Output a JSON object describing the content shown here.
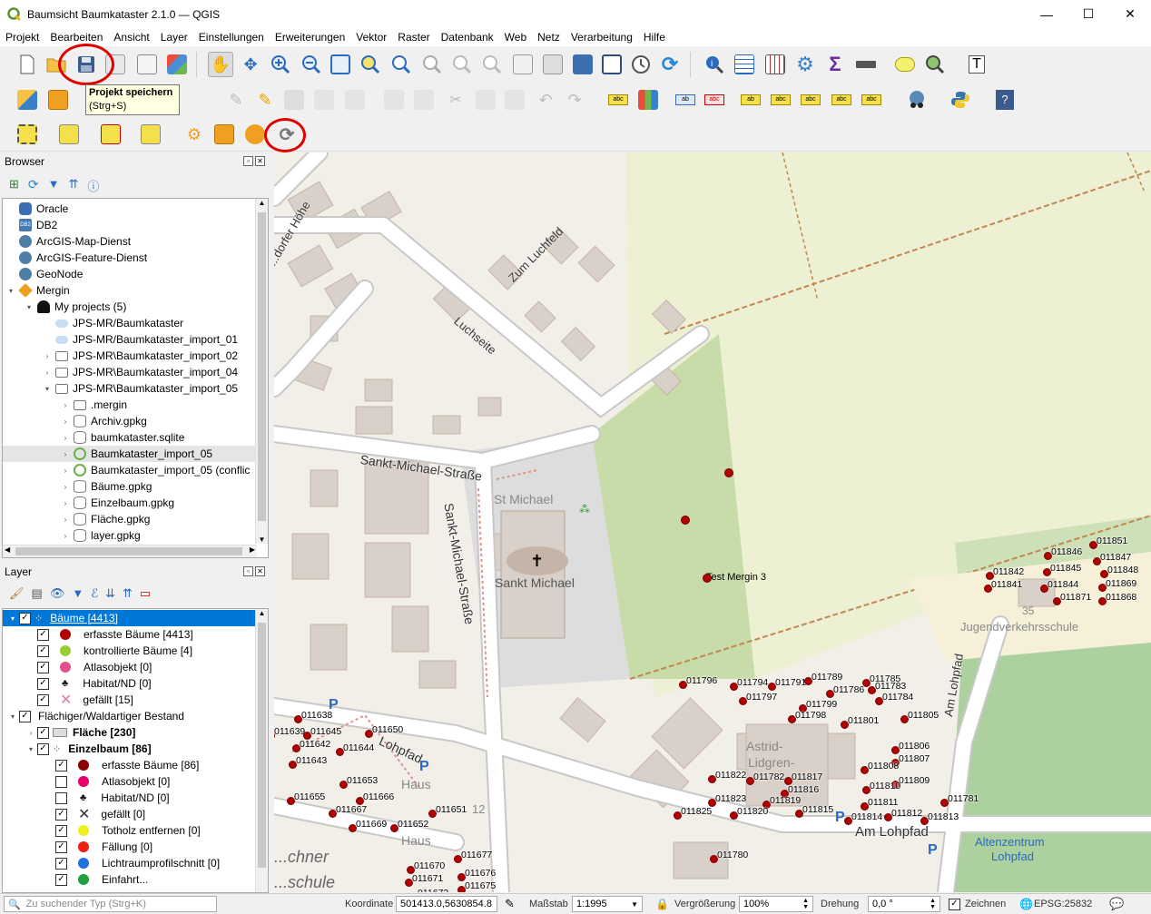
{
  "window": {
    "title": "Baumsicht Baumkataster 2.1.0 — QGIS",
    "minimize": "—",
    "maximize": "☐",
    "close": "✕"
  },
  "menu": [
    "Projekt",
    "Bearbeiten",
    "Ansicht",
    "Layer",
    "Einstellungen",
    "Erweiterungen",
    "Vektor",
    "Raster",
    "Datenbank",
    "Web",
    "Netz",
    "Verarbeitung",
    "Hilfe"
  ],
  "tooltip": {
    "title": "Projekt speichern",
    "shortcut": "(Strg+S)"
  },
  "browser": {
    "title": "Browser",
    "items": [
      {
        "label": "Oracle",
        "indent": 0,
        "expand": "",
        "icon": "oracle-icon",
        "color": "#3a6fb5"
      },
      {
        "label": "DB2",
        "indent": 0,
        "expand": "",
        "icon": "db2-icon",
        "color": "#4a7ab5"
      },
      {
        "label": "ArcGIS-Map-Dienst",
        "indent": 0,
        "expand": "",
        "icon": "globe-icon",
        "color": "#4d7ea8"
      },
      {
        "label": "ArcGIS-Feature-Dienst",
        "indent": 0,
        "expand": "",
        "icon": "globe-icon",
        "color": "#4d7ea8"
      },
      {
        "label": "GeoNode",
        "indent": 0,
        "expand": "",
        "icon": "geonode-icon",
        "color": "#4d7ea8"
      },
      {
        "label": "Mergin",
        "indent": 0,
        "expand": "▾",
        "icon": "mergin-icon",
        "color": "#f0a020"
      },
      {
        "label": "My projects (5)",
        "indent": 1,
        "expand": "▾",
        "icon": "user-icon",
        "color": "#111"
      },
      {
        "label": "JPS-MR/Baumkataster",
        "indent": 2,
        "expand": "",
        "icon": "cloud-icon",
        "color": "#c8def2"
      },
      {
        "label": "JPS-MR/Baumkataster_import_01",
        "indent": 2,
        "expand": "",
        "icon": "cloud-icon",
        "color": "#c8def2"
      },
      {
        "label": "JPS-MR\\Baumkataster_import_02",
        "indent": 2,
        "expand": "›",
        "icon": "folder-icon",
        "color": "#fff"
      },
      {
        "label": "JPS-MR\\Baumkataster_import_04",
        "indent": 2,
        "expand": "›",
        "icon": "folder-icon",
        "color": "#fff"
      },
      {
        "label": "JPS-MR\\Baumkataster_import_05",
        "indent": 2,
        "expand": "▾",
        "icon": "folder-icon",
        "color": "#fff"
      },
      {
        "label": ".mergin",
        "indent": 3,
        "expand": "›",
        "icon": "folder-icon",
        "color": "#fff"
      },
      {
        "label": "Archiv.gpkg",
        "indent": 3,
        "expand": "›",
        "icon": "database-icon",
        "color": "#fff"
      },
      {
        "label": "baumkataster.sqlite",
        "indent": 3,
        "expand": "›",
        "icon": "database-icon",
        "color": "#fff"
      },
      {
        "label": "Baumkataster_import_05",
        "indent": 3,
        "expand": "›",
        "icon": "qgis-icon",
        "color": "#6ab04c"
      },
      {
        "label": "Baumkataster_import_05 (conflic",
        "indent": 3,
        "expand": "›",
        "icon": "qgis-icon",
        "color": "#6ab04c"
      },
      {
        "label": "Bäume.gpkg",
        "indent": 3,
        "expand": "›",
        "icon": "database-icon",
        "color": "#fff"
      },
      {
        "label": "Einzelbaum.gpkg",
        "indent": 3,
        "expand": "›",
        "icon": "database-icon",
        "color": "#fff"
      },
      {
        "label": "Fläche.gpkg",
        "indent": 3,
        "expand": "›",
        "icon": "database-icon",
        "color": "#fff"
      },
      {
        "label": "layer.gpkg",
        "indent": 3,
        "expand": "›",
        "icon": "database-icon",
        "color": "#fff"
      }
    ]
  },
  "layers": {
    "title": "Layer",
    "items": [
      {
        "label": "Bäume [4413]",
        "type": "group-selected",
        "indent": 0,
        "checked": true,
        "expand": "▾"
      },
      {
        "label": "erfasste Bäume [4413]",
        "type": "sym",
        "indent": 1,
        "checked": true,
        "color": "#b00000"
      },
      {
        "label": "kontrollierte Bäume [4]",
        "type": "sym",
        "indent": 1,
        "checked": true,
        "color": "#9acd32"
      },
      {
        "label": "Atlasobjekt [0]",
        "type": "sym",
        "indent": 1,
        "checked": true,
        "color": "#e0508a"
      },
      {
        "label": "Habitat/ND [0]",
        "type": "tree",
        "indent": 1,
        "checked": true,
        "color": "#111"
      },
      {
        "label": "gefällt [15]",
        "type": "cross",
        "indent": 1,
        "checked": true,
        "color": "#e07aa8"
      },
      {
        "label": "Flächiger/Waldartiger Bestand",
        "type": "group",
        "indent": 0,
        "checked": true,
        "expand": "▾"
      },
      {
        "label": "Fläche [230]",
        "type": "bold",
        "indent": 1,
        "checked": true,
        "expand": "›"
      },
      {
        "label": "Einzelbaum [86]",
        "type": "bold",
        "indent": 1,
        "checked": true,
        "expand": "▾"
      },
      {
        "label": "erfasste Bäume [86]",
        "type": "sym",
        "indent": 2,
        "checked": true,
        "color": "#8b0000"
      },
      {
        "label": "Atlasobjekt [0]",
        "type": "sym",
        "indent": 2,
        "checked": false,
        "color": "#e8006f"
      },
      {
        "label": "Habitat/ND [0]",
        "type": "tree",
        "indent": 2,
        "checked": false,
        "color": "#111"
      },
      {
        "label": "gefällt [0]",
        "type": "cross",
        "indent": 2,
        "checked": true,
        "color": "#333"
      },
      {
        "label": "Totholz entfernen [0]",
        "type": "sym",
        "indent": 2,
        "checked": true,
        "color": "#f0f020"
      },
      {
        "label": "Fällung [0]",
        "type": "sym",
        "indent": 2,
        "checked": true,
        "color": "#f02010"
      },
      {
        "label": "Lichtraumprofilschnitt [0]",
        "type": "sym",
        "indent": 2,
        "checked": true,
        "color": "#2070e0"
      },
      {
        "label": "Einfahrt...",
        "type": "sym",
        "indent": 2,
        "checked": true,
        "color": "#20a040"
      }
    ]
  },
  "map": {
    "streets": [
      "Sankt-Michael-Straße",
      "Sankt-Michael-Straße",
      "Luchseite",
      "Zum Luchfeld",
      "...dorfer Höhe",
      "Lohpfad",
      "Am Lohpfad",
      "Am Lohpfad"
    ],
    "places": [
      "St Michael",
      "Sankt Michael",
      "Astrid-",
      "Lidgren-",
      "Haus",
      "Haus",
      "Jugendverkehrsschule",
      "Altenzentrum",
      "Lohpfad",
      "...chner",
      "...schule",
      "Test Mergin 3",
      "35",
      "12"
    ],
    "tree_labels": [
      "011851",
      "011846",
      "011847",
      "011842",
      "011845",
      "011848",
      "011841",
      "011844",
      "011869",
      "011871",
      "011868",
      "011796",
      "011794",
      "011791",
      "011789",
      "011785",
      "011797",
      "011786",
      "011783",
      "011784",
      "011799",
      "011798",
      "011801",
      "011805",
      "011638",
      "011639",
      "011645",
      "011650",
      "011642",
      "011644",
      "011643",
      "011806",
      "011807",
      "011808",
      "011809",
      "011822",
      "011782",
      "011817",
      "011816",
      "011810",
      "011653",
      "011655",
      "011666",
      "011667",
      "011651",
      "011823",
      "011819",
      "011825",
      "011820",
      "011815",
      "011811",
      "011812",
      "011781",
      "011814",
      "011813",
      "011669",
      "011652",
      "011677",
      "011780",
      "011670",
      "011676",
      "011671",
      "011675",
      "011673"
    ]
  },
  "status": {
    "search_placeholder": "Zu suchender Typ (Strg+K)",
    "coord_label": "Koordinate",
    "coord_value": "501413.0,5630854.8",
    "scale_label": "Maßstab",
    "scale_value": "1:1995",
    "zoom_label": "Vergrößerung",
    "zoom_value": "100%",
    "rotation_label": "Drehung",
    "rotation_value": "0,0 °",
    "render_label": "Zeichnen",
    "crs": "EPSG:25832"
  }
}
